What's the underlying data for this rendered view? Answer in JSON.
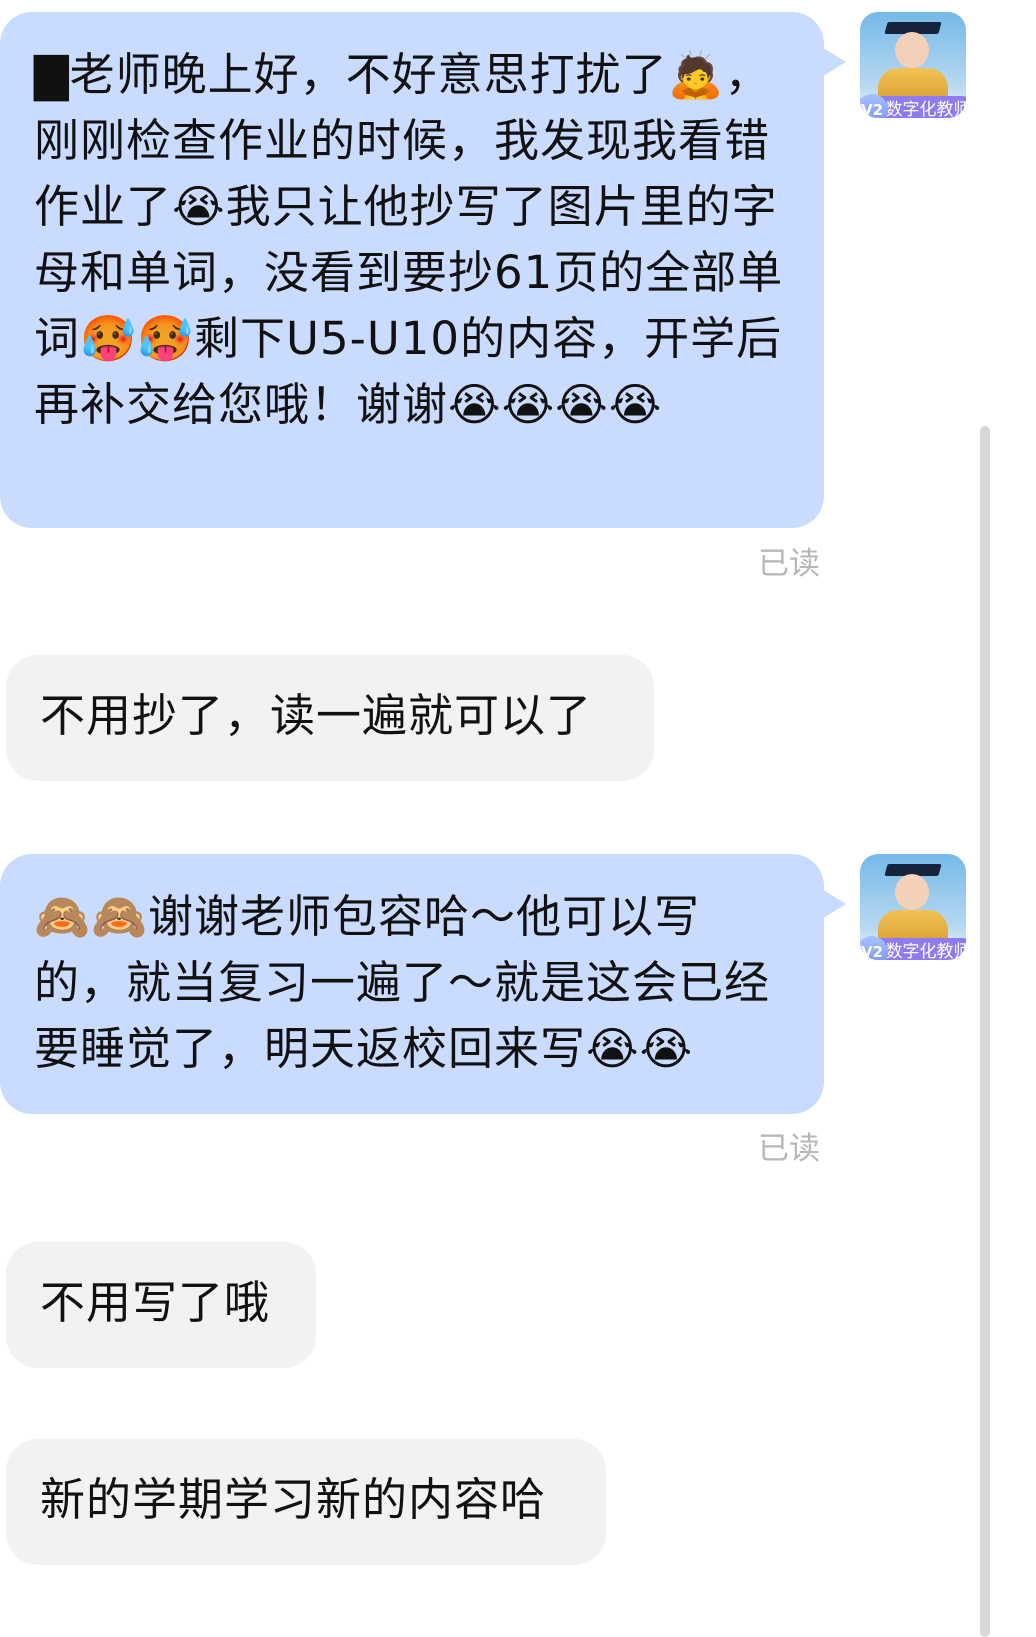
{
  "messages": [
    {
      "id": "msg-1",
      "side": "me",
      "text": "▇老师晚上好，不好意思打扰了🙇，刚刚检查作业的时候，我发现我看错作业了😭我只让他抄写了图片里的字母和单词，没看到要抄61页的全部单词🥵🥵剩下U5-U10的内容，开学后再补交给您哦！谢谢😭😭😭😭",
      "read": "已读"
    },
    {
      "id": "msg-2",
      "side": "other",
      "text": "不用抄了，读一遍就可以了"
    },
    {
      "id": "msg-3",
      "side": "me",
      "text": "🙈🙈谢谢老师包容哈～他可以写的，就当复习一遍了～就是这会已经要睡觉了，明天返校回来写😭😭",
      "read": "已读"
    },
    {
      "id": "msg-4",
      "side": "other",
      "text": "不用写了哦"
    },
    {
      "id": "msg-5",
      "side": "other",
      "text": "新的学期学习新的内容哈"
    }
  ],
  "avatar": {
    "badge_level": "V2",
    "badge_label": "数字化教师"
  },
  "colors": {
    "me_bubble": "#c9dcff",
    "other_bubble": "#f1f2f4",
    "badge": "#8c7bf1",
    "read_text": "#b7b7b7"
  },
  "icons": {
    "avatar_icon": "graduate-avatar-icon",
    "badge_icon": "v2-badge-icon"
  }
}
